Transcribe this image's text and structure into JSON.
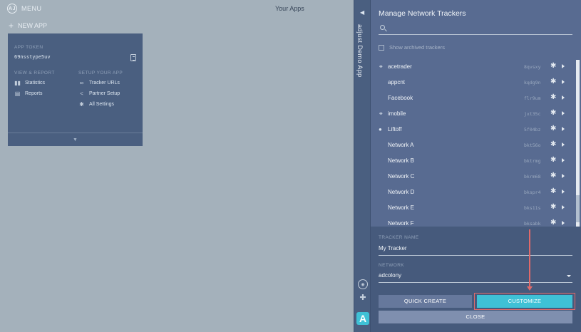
{
  "topbar": {
    "menu_label": "MENU",
    "menu_icon_text": "AJ",
    "page_title": "Your Apps"
  },
  "new_app": {
    "label": "NEW APP"
  },
  "app_card": {
    "token_label": "APP TOKEN",
    "token_value": "69nsstype5uv",
    "view_report_label": "VIEW & REPORT",
    "setup_label": "SETUP YOUR APP",
    "links_left": [
      {
        "icon": "statistics-icon",
        "label": "Statistics"
      },
      {
        "icon": "reports-icon",
        "label": "Reports"
      }
    ],
    "links_right": [
      {
        "icon": "link-icon",
        "label": "Tracker URLs"
      },
      {
        "icon": "share-icon",
        "label": "Partner Setup"
      },
      {
        "icon": "gear-icon",
        "label": "All Settings"
      }
    ]
  },
  "sidestrip": {
    "app_name": "adjust Demo App",
    "logo_text": "A"
  },
  "panel": {
    "title": "Manage Network Trackers",
    "search_placeholder": "",
    "show_archived_label": "Show archived trackers",
    "trackers": [
      {
        "name": "acetrader",
        "token": "8qvsxy",
        "indent": false,
        "lead_icon": "link-icon"
      },
      {
        "name": "appcnt",
        "token": "kqdg9n",
        "indent": true,
        "lead_icon": ""
      },
      {
        "name": "Facebook",
        "token": "flr9um",
        "indent": true,
        "lead_icon": ""
      },
      {
        "name": "imobile",
        "token": "jxt35c",
        "indent": false,
        "lead_icon": "link-icon"
      },
      {
        "name": "Liftoff",
        "token": "5f04bz",
        "indent": false,
        "lead_icon": "status-icon"
      },
      {
        "name": "Network A",
        "token": "bkt56o",
        "indent": true,
        "lead_icon": ""
      },
      {
        "name": "Network B",
        "token": "bktrmg",
        "indent": true,
        "lead_icon": ""
      },
      {
        "name": "Network C",
        "token": "bkrm68",
        "indent": true,
        "lead_icon": ""
      },
      {
        "name": "Network D",
        "token": "bkspr4",
        "indent": true,
        "lead_icon": ""
      },
      {
        "name": "Network E",
        "token": "bks11s",
        "indent": true,
        "lead_icon": ""
      },
      {
        "name": "Network F",
        "token": "bksabk",
        "indent": true,
        "lead_icon": ""
      }
    ],
    "tracker_name_label": "TRACKER NAME",
    "tracker_name_value": "My Tracker",
    "network_label": "NETWORK",
    "network_value": "adcolony",
    "quick_create_label": "QUICK CREATE",
    "customize_label": "CUSTOMIZE",
    "close_label": "CLOSE"
  },
  "colors": {
    "accent": "#3fc1d6",
    "panel": "#586b91",
    "annotation": "#e06a6a"
  }
}
